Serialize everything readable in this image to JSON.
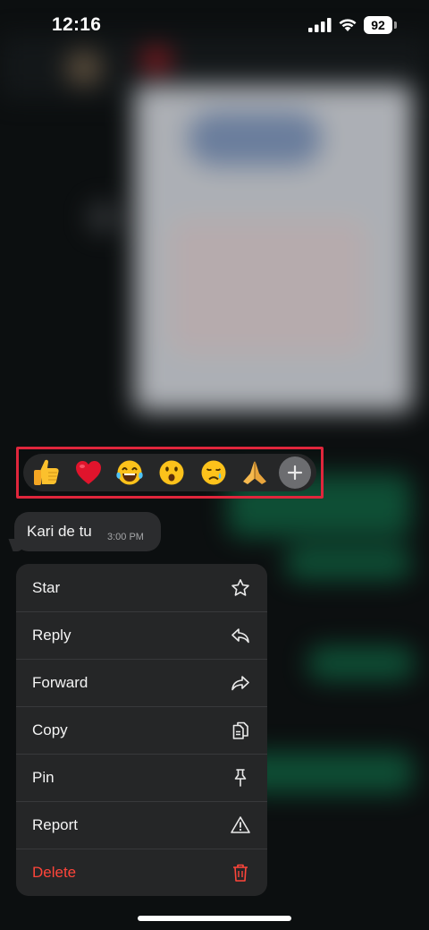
{
  "status_bar": {
    "time": "12:16",
    "battery_level": "92",
    "icons": [
      "cellular-signal-icon",
      "wifi-icon",
      "battery-icon"
    ]
  },
  "reactions": {
    "items": [
      {
        "name": "thumbs-up-emoji"
      },
      {
        "name": "red-heart-emoji"
      },
      {
        "name": "tears-of-joy-emoji"
      },
      {
        "name": "surprised-face-emoji"
      },
      {
        "name": "crying-face-emoji"
      },
      {
        "name": "folded-hands-emoji"
      }
    ],
    "more_icon": "plus-icon",
    "highlight_color": "#e0263c"
  },
  "message": {
    "text": "Kari de tu",
    "time": "3:00 PM"
  },
  "menu": {
    "items": [
      {
        "label": "Star",
        "icon": "star-icon"
      },
      {
        "label": "Reply",
        "icon": "reply-icon"
      },
      {
        "label": "Forward",
        "icon": "forward-icon"
      },
      {
        "label": "Copy",
        "icon": "copy-icon"
      },
      {
        "label": "Pin",
        "icon": "pin-icon"
      },
      {
        "label": "Report",
        "icon": "warning-icon"
      },
      {
        "label": "Delete",
        "icon": "trash-icon"
      }
    ],
    "danger_color": "#ff453a"
  }
}
